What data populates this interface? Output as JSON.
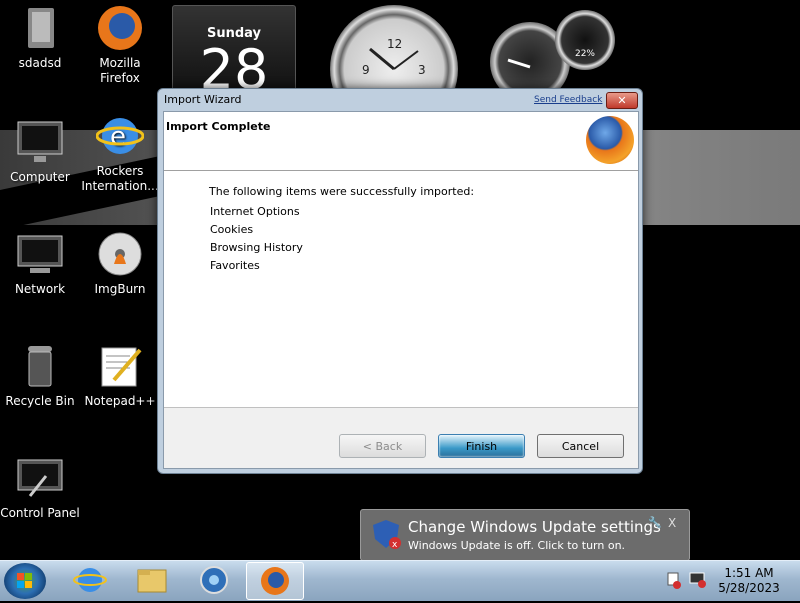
{
  "desktop": {
    "icons": [
      {
        "label": "sdadsd"
      },
      {
        "label": "Mozilla Firefox"
      },
      {
        "label": "Computer"
      },
      {
        "label": "Rockers Internation..."
      },
      {
        "label": "Network"
      },
      {
        "label": "ImgBurn"
      },
      {
        "label": "Recycle Bin"
      },
      {
        "label": "Notepad++"
      },
      {
        "label": "Control Panel"
      }
    ],
    "calendar": {
      "day": "Sunday",
      "date": "28"
    },
    "clock": {
      "n12": "12",
      "n9": "9",
      "n3": "3"
    },
    "cpu_meter": {
      "value": "22%"
    }
  },
  "dialog": {
    "title": "Import Wizard",
    "send_feedback": "Send Feedback",
    "close_label": "✕",
    "header_title": "Import Complete",
    "intro": "The following items were successfully imported:",
    "items": [
      "Internet Options",
      "Cookies",
      "Browsing History",
      "Favorites"
    ],
    "back_label": "< Back",
    "finish_label": "Finish",
    "cancel_label": "Cancel"
  },
  "notification": {
    "title": "Change Windows Update settings",
    "text": "Windows Update is off. Click to turn on.",
    "close": "X"
  },
  "taskbar": {
    "time": "1:51 AM",
    "date": "5/28/2023"
  },
  "colors": {
    "dialog_frame": "#bfcfdf",
    "taskbar": "#9fb7cf"
  }
}
